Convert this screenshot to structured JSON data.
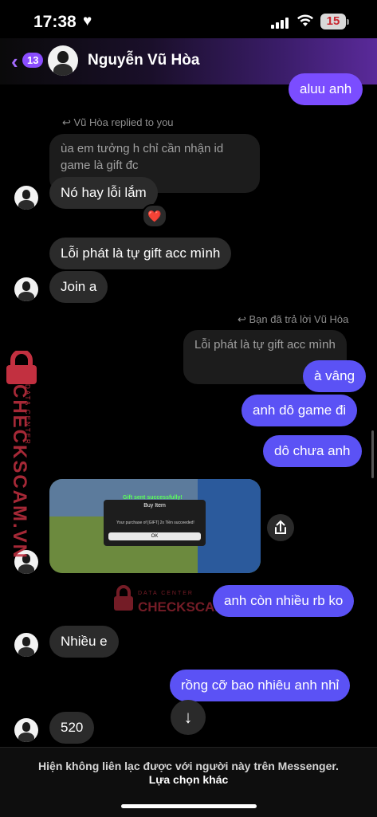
{
  "status_bar": {
    "time": "17:38",
    "battery": "15"
  },
  "header": {
    "back_count": "13",
    "contact_name": "Nguyễn Vũ Hòa"
  },
  "messages": {
    "m1": "aluu anh",
    "reply1_label": "Vũ Hòa replied to you",
    "reply1_quote": "ùa em tưởng h chỉ cần nhận id game là gift đc",
    "m2": "Nó hay lỗi lắm",
    "m2_reaction": "❤️",
    "m3": "Lỗi phát là tự gift acc mình",
    "m4": "Join a",
    "reply2_label": "Bạn đã trả lời Vũ Hòa",
    "reply2_quote": "Lỗi phát là tự gift acc mình",
    "m5": "à vâng",
    "m6": "anh dô game đi",
    "m7": "dô chưa anh",
    "m8": "anh còn nhiều rb ko",
    "m9": "Nhiều e",
    "m10": "rồng cỡ bao nhiêu anh nhỉ",
    "m11": "520"
  },
  "screenshot_image": {
    "gift_text": "Gift sent successfully!",
    "dialog_title": "Buy Item",
    "dialog_text": "Your purchase of [GIFT] 2x Tiền succeeded!",
    "ok_label": "OK"
  },
  "watermark": {
    "brand": "CHECKSCAM.VN",
    "tagline": "DATA CENTER"
  },
  "footer": {
    "note": "Hiện không liên lạc được với người này trên Messenger.",
    "link": "Lựa chọn khác"
  },
  "colors": {
    "outgoing": "#5b52f5",
    "incoming": "#2b2b2b",
    "accent": "#a56bff"
  }
}
